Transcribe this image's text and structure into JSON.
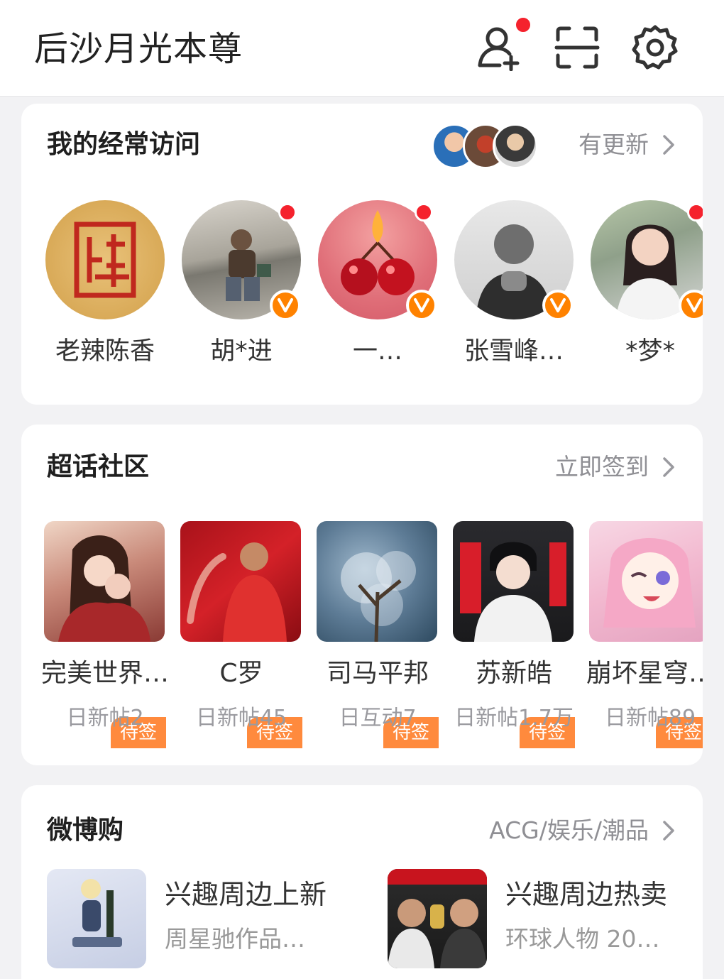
{
  "header": {
    "title": "后沙月光本尊",
    "icons": [
      "add-friend-icon",
      "scan-icon",
      "gear-icon"
    ],
    "has_notification": true
  },
  "frequent_visits": {
    "title": "我的经常访问",
    "action": "有更新",
    "items": [
      {
        "name": "老辣陈香",
        "verified": false,
        "has_update": false
      },
      {
        "name": "胡*进",
        "verified": true,
        "has_update": true
      },
      {
        "name": "一…",
        "verified": true,
        "has_update": true
      },
      {
        "name": "张雪峰…",
        "verified": true,
        "has_update": false
      },
      {
        "name": "*梦*",
        "verified": true,
        "has_update": true
      }
    ]
  },
  "super_topics": {
    "title": "超话社区",
    "action": "立即签到",
    "items": [
      {
        "name": "完美世界…",
        "stat": "日新帖2",
        "tag": "待签"
      },
      {
        "name": "C罗",
        "stat": "日新帖45",
        "tag": "待签"
      },
      {
        "name": "司马平邦",
        "stat": "日互动7",
        "tag": "待签"
      },
      {
        "name": "苏新皓",
        "stat": "日新帖1.7万",
        "tag": "待签"
      },
      {
        "name": "崩坏星穹…",
        "stat": "日新帖89",
        "tag": "待签"
      }
    ]
  },
  "weibo_shop": {
    "title": "微博购",
    "action": "ACG/娱乐/潮品",
    "items": [
      {
        "title": "兴趣周边上新",
        "subtitle": "周星驰作品…"
      },
      {
        "title": "兴趣周边热卖",
        "subtitle": "环球人物 20…"
      }
    ]
  },
  "colors": {
    "accent": "#ff8200",
    "tag": "#ff8a3d",
    "badge": "#f5222d",
    "muted": "#8f8f94"
  }
}
